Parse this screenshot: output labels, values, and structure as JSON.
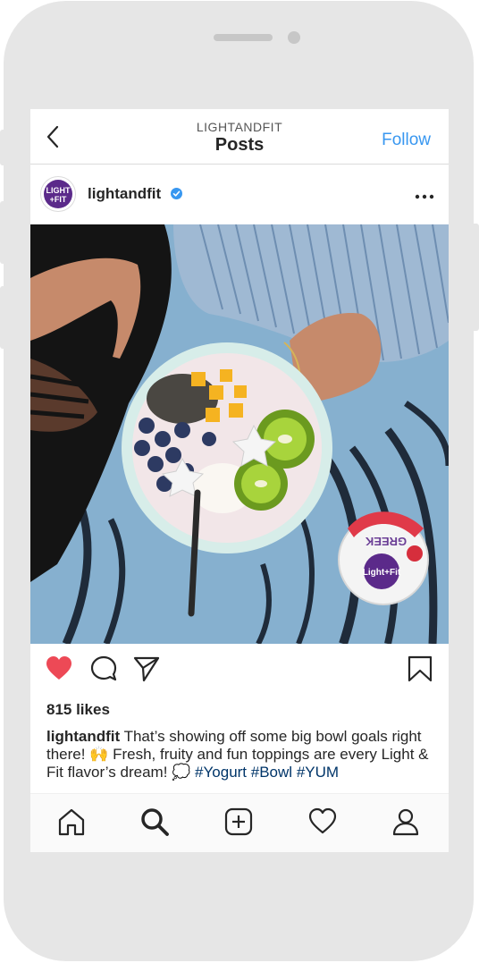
{
  "header": {
    "subtitle": "LIGHTANDFIT",
    "title": "Posts",
    "follow_label": "Follow"
  },
  "post": {
    "avatar_text": "LIGHT +FIT",
    "username": "lightandfit",
    "likes": "815 likes",
    "caption": {
      "username": "lightandfit",
      "text": "That’s showing off some big bowl goals right there! 🙌 Fresh, fruity and fun toppings are every Light & Fit flavor’s dream! 💭",
      "hashtags": [
        "#Yogurt",
        "#Bowl",
        "#YUM"
      ]
    },
    "yogurt_cup": {
      "brand": "Light+Fit",
      "label": "GREEK"
    }
  },
  "icons": {
    "back": "chevron-left-icon",
    "more": "more-horizontal-icon",
    "like": "heart-filled-icon",
    "comment": "comment-icon",
    "share": "send-icon",
    "save": "bookmark-icon",
    "home": "home-icon",
    "search": "search-icon",
    "add": "add-post-icon",
    "activity": "heart-outline-icon",
    "profile": "profile-icon"
  },
  "colors": {
    "accent": "#3897f0",
    "like": "#ed4956",
    "hashtag": "#003569"
  }
}
